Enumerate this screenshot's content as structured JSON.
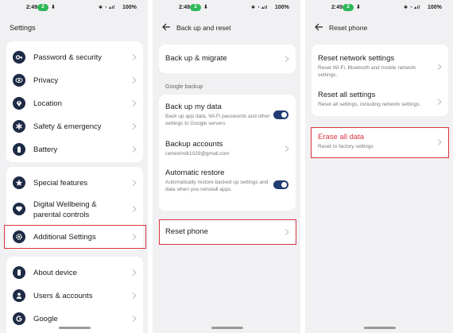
{
  "status_bar": {
    "time": "2:49",
    "pill": "2",
    "icons": "ﾎ ☂ ✈ ▮▮",
    "battery": "100%"
  },
  "panel1": {
    "title": "Settings",
    "items": [
      {
        "label": "Password & security",
        "icon": "key-icon"
      },
      {
        "label": "Privacy",
        "icon": "eye-icon"
      },
      {
        "label": "Location",
        "icon": "location-pin-icon"
      },
      {
        "label": "Safety & emergency",
        "icon": "asterisk-icon"
      },
      {
        "label": "Battery",
        "icon": "battery-icon"
      },
      {
        "label": "Special features",
        "icon": "star-icon"
      },
      {
        "label": "Digital Wellbeing &",
        "label2": "parental controls",
        "icon": "heart-hand-icon"
      },
      {
        "label": "Additional Settings",
        "icon": "gear-icon"
      },
      {
        "label": "About device",
        "icon": "phone-icon"
      },
      {
        "label": "Users & accounts",
        "icon": "person-icon"
      },
      {
        "label": "Google",
        "icon": "google-g-icon"
      }
    ]
  },
  "panel2": {
    "title": "Back up and reset",
    "backup_migrate": "Back up & migrate",
    "section_caption": "Google backup",
    "backup_data": {
      "title": "Back up my data",
      "subtitle": "Back up app data, Wi-Fi passwords and other settings to Google servers",
      "enabled": true
    },
    "backup_accounts": {
      "title": "Backup accounts",
      "subtitle": "rameshnik1029@gmail.com"
    },
    "auto_restore": {
      "title": "Automatic restore",
      "subtitle": "Automatically restore backed up settings and data when you reinstall apps.",
      "enabled": true
    },
    "reset_phone": "Reset phone"
  },
  "panel3": {
    "title": "Reset phone",
    "reset_network": {
      "title": "Reset network settings",
      "subtitle": "Reset Wi-Fi, Bluetooth and mobile network settings."
    },
    "reset_all": {
      "title": "Reset all settings",
      "subtitle": "Reset all settings, including network settings."
    },
    "erase_all": {
      "title": "Erase all data",
      "subtitle": "Reset to factory settings"
    }
  },
  "colors": {
    "highlight": "#d9363e",
    "icon_bg": "#1d2b45",
    "toggle_on": "#213b73",
    "panel_bg": "#f1f1f3"
  }
}
